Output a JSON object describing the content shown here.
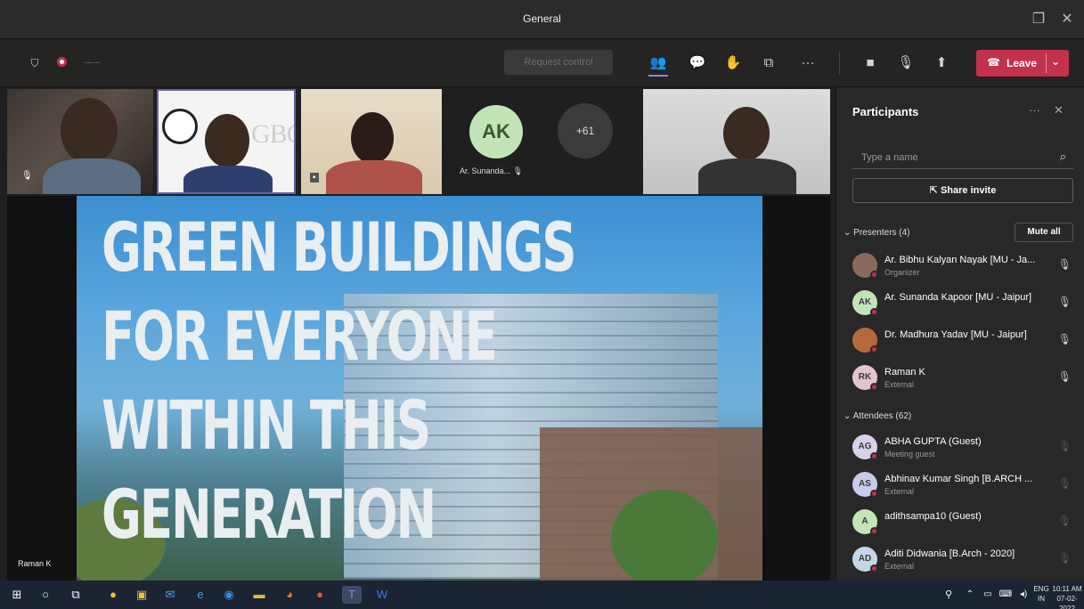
{
  "window": {
    "title": "General"
  },
  "toolbar": {
    "record_icons": [
      "shield-icon",
      "record-icon",
      "timer-icon"
    ],
    "request_control_label": "Request control",
    "leave_label": "Leave",
    "more_label": "···"
  },
  "video_strip": {
    "ak_initials": "AK",
    "ak_name": "Ar. Sunanda...",
    "more_count": "+61",
    "gbc_text": "GBC"
  },
  "stage": {
    "slide_lines": [
      "GREEN BUILDINGS",
      "FOR EVERYONE",
      "WITHIN THIS",
      "GENERATION"
    ],
    "speaker_name": "Raman K"
  },
  "participants": {
    "title": "Participants",
    "search_placeholder": "Type a name",
    "share_invite": "Share invite",
    "presenters_header": "Presenters (4)",
    "mute_all": "Mute all",
    "attendees_header": "Attendees (62)",
    "presenters": [
      {
        "initials": "",
        "name": "Ar. Bibhu Kalyan Nayak [MU - Ja...",
        "sub": "Organizer",
        "avatar_color": "#8a6a5a"
      },
      {
        "initials": "AK",
        "name": "Ar. Sunanda Kapoor [MU - Jaipur]",
        "sub": "",
        "avatar_color": "#c2e5b8"
      },
      {
        "initials": "",
        "name": "Dr. Madhura Yadav [MU - Jaipur]",
        "sub": "",
        "avatar_color": "#b56a3a"
      },
      {
        "initials": "RK",
        "name": "Raman K",
        "sub": "External",
        "avatar_color": "#e3c5cf"
      }
    ],
    "attendees": [
      {
        "initials": "AG",
        "name": "ABHA GUPTA (Guest)",
        "sub": "Meeting guest",
        "avatar_color": "#d9d0e9"
      },
      {
        "initials": "AS",
        "name": "Abhinav Kumar Singh [B.ARCH ...",
        "sub": "External",
        "avatar_color": "#c8cbe9"
      },
      {
        "initials": "A",
        "name": "adithsampa10 (Guest)",
        "sub": "",
        "avatar_color": "#c2e5b8"
      },
      {
        "initials": "AD",
        "name": "Aditi Didwania [B.Arch - 2020]",
        "sub": "External",
        "avatar_color": "#c6d6e9"
      }
    ]
  },
  "taskbar": {
    "lang_top": "ENG",
    "lang_bottom": "IN",
    "time": "10:11 AM",
    "date": "07-02-2022"
  }
}
